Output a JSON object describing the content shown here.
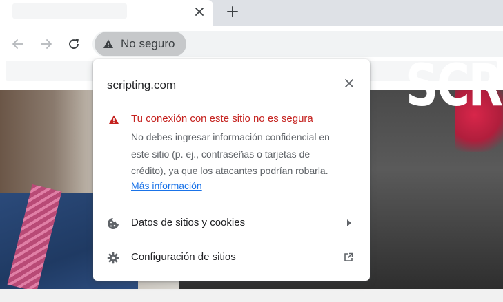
{
  "browser": {
    "tab": {
      "close_icon": "close-icon"
    },
    "new_tab_icon": "plus-icon",
    "nav": {
      "back_icon": "arrow-left-icon",
      "forward_icon": "arrow-right-icon",
      "reload_icon": "reload-icon"
    },
    "security_chip": {
      "label": "No seguro",
      "icon": "warning-icon"
    }
  },
  "popup": {
    "site": "scripting.com",
    "close_icon": "close-icon",
    "warning": {
      "heading": "Tu conexión con este sitio no es segura",
      "body_lines": [
        "No debes ingresar información confidencial en",
        "este sitio (p. ej., contraseñas o tarjetas de",
        "crédito), ya que los atacantes podrían robarla."
      ],
      "link": "Más información",
      "color": "#c5221f"
    },
    "menu": [
      {
        "label": "Datos de sitios y cookies",
        "icon": "cookie-icon",
        "trailing": "arrow-right-icon"
      },
      {
        "label": "Configuración de sitios",
        "icon": "gear-icon",
        "trailing": "external-link-icon"
      }
    ]
  },
  "page": {
    "hero_text": "SCR"
  },
  "colors": {
    "link": "#1a73e8",
    "chip_bg": "#c6c8ca",
    "tabstrip": "#dee1e6"
  }
}
